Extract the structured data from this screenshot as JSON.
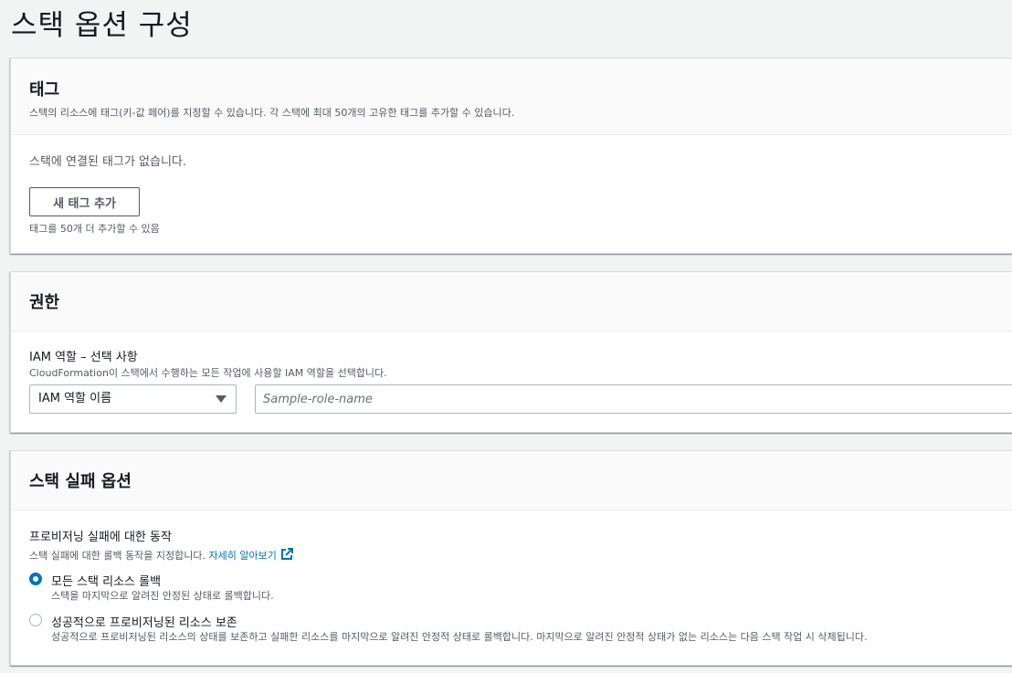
{
  "page": {
    "title": "스택 옵션 구성"
  },
  "tags": {
    "title": "태그",
    "description": "스택의 리소스에 태그(키-값 페어)를 지정할 수 있습니다. 각 스택에 최대 50개의 고유한 태그를 추가할 수 있습니다.",
    "empty_text": "스택에 연결된 태그가 없습니다.",
    "add_button": "새 태그 추가",
    "hint": "태그를 50개 더 추가할 수 있음"
  },
  "permissions": {
    "title": "권한",
    "iam_label": "IAM 역할 – 선택 사항",
    "iam_description": "CloudFormation이 스택에서 수행하는 모든 작업에 사용할 IAM 역할을 선택합니다.",
    "select_value": "IAM 역할 이름",
    "role_placeholder": "Sample-role-name"
  },
  "failure_options": {
    "title": "스택 실패 옵션",
    "behavior_label": "프로비저닝 실패에 대한 동작",
    "behavior_description": "스택 실패에 대한 롤백 동작을 지정합니다.",
    "learn_more": "자세히 알아보기",
    "options": [
      {
        "label": "모든 스택 리소스 롤백",
        "description": "스택을 마지막으로 알려진 안정된 상태로 롤백합니다.",
        "selected": true
      },
      {
        "label": "성공적으로 프로비저닝된 리소스 보존",
        "description": "성공적으로 프로비저닝된 리소스의 상태를 보존하고 실패한 리소스를 마지막으로 알려진 안정적 상태로 롤백합니다. 마지막으로 알려진 안정적 상태가 없는 리소스는 다음 스택 작업 시 삭제됩니다.",
        "selected": false
      }
    ]
  },
  "icons": {
    "dropdown": "caret-down-icon",
    "external_link": "external-link-icon"
  },
  "colors": {
    "link": "#0073bb",
    "radio_selected": "#0073bb",
    "background": "#f2f3f3"
  }
}
